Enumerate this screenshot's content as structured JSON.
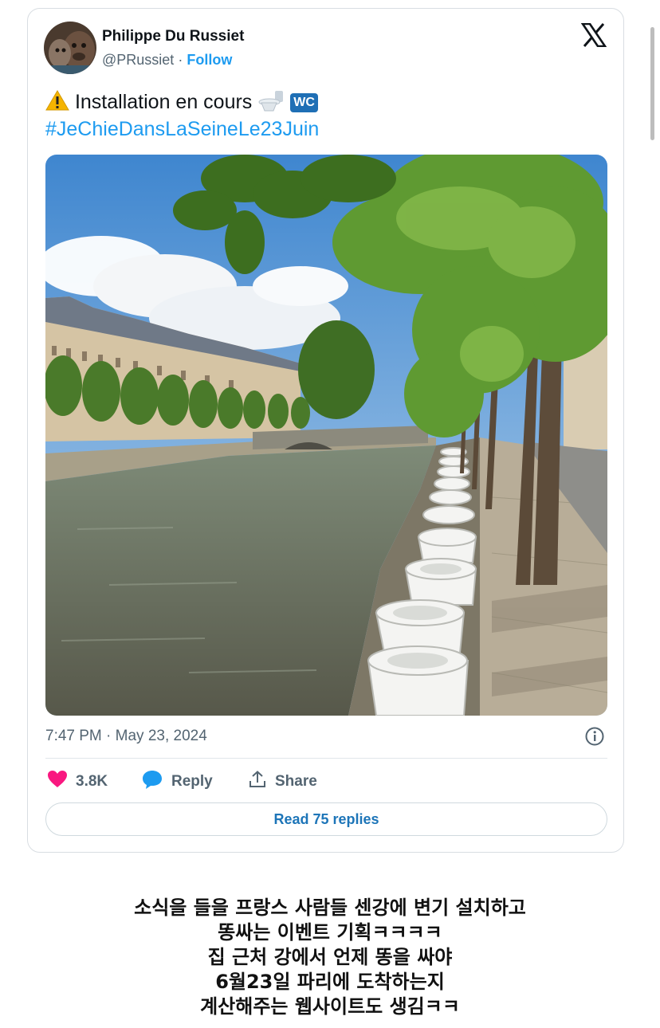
{
  "tweet": {
    "author_name": "Philippe Du Russiet",
    "handle": "@PRussiet",
    "separator": "·",
    "follow_label": "Follow",
    "text": "Installation en cours",
    "hashtag": "#JeChieDansLaSeineLe23Juin",
    "badge": "WC",
    "timestamp": "7:47 PM · May 23, 2024",
    "likes": "3.8K",
    "reply_label": "Reply",
    "share_label": "Share",
    "read_replies_label": "Read 75 replies"
  },
  "icons": {
    "warning": "warning-icon",
    "toilet": "toilet-icon",
    "x_logo": "x-logo-icon",
    "info": "info-icon",
    "heart": "heart-icon",
    "reply": "reply-bubble-icon",
    "share": "share-icon"
  },
  "colors": {
    "link": "#1d9bf0",
    "heart": "#f91880",
    "reply": "#1d9bf0",
    "text_secondary": "#536471"
  },
  "caption": {
    "lines": [
      "소식을 들을 프랑스 사람들 센강에 변기 설치하고",
      "똥싸는 이벤트 기획ㅋㅋㅋㅋ",
      "집 근처 강에서 언제 똥을 싸야",
      "6월23일 파리에 도착하는지",
      "계산해주는 웹사이트도 생김ㅋㅋ"
    ]
  }
}
